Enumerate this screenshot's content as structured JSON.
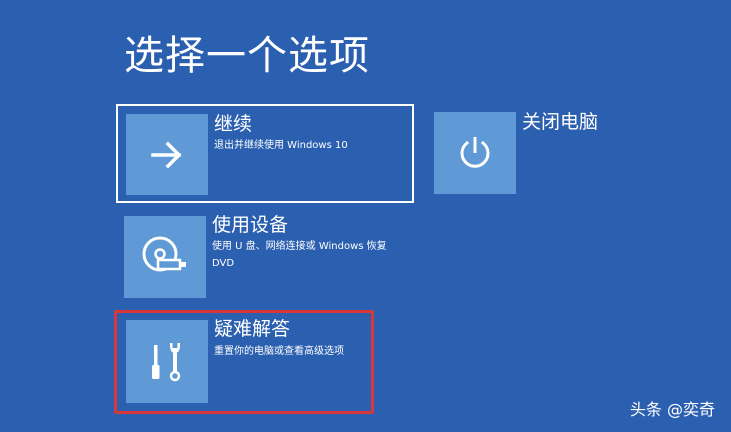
{
  "page": {
    "title": "选择一个选项"
  },
  "options": {
    "continue": {
      "title": "继续",
      "description": "退出并继续使用 Windows 10",
      "icon": "arrow-right-icon"
    },
    "device": {
      "title": "使用设备",
      "description": "使用 U 盘、网络连接或 Windows 恢复 DVD",
      "icon": "disc-usb-icon"
    },
    "troubleshoot": {
      "title": "疑难解答",
      "description": "重置你的电脑或查看高级选项",
      "icon": "tools-icon"
    },
    "shutdown": {
      "title": "关闭电脑",
      "icon": "power-icon"
    }
  },
  "watermark": {
    "text": "头条 @奕奇"
  },
  "colors": {
    "background": "#2b5fb0",
    "tile": "#5f9ad6",
    "highlight_outline": "#d6383a",
    "focus_outline": "#ffffff"
  }
}
